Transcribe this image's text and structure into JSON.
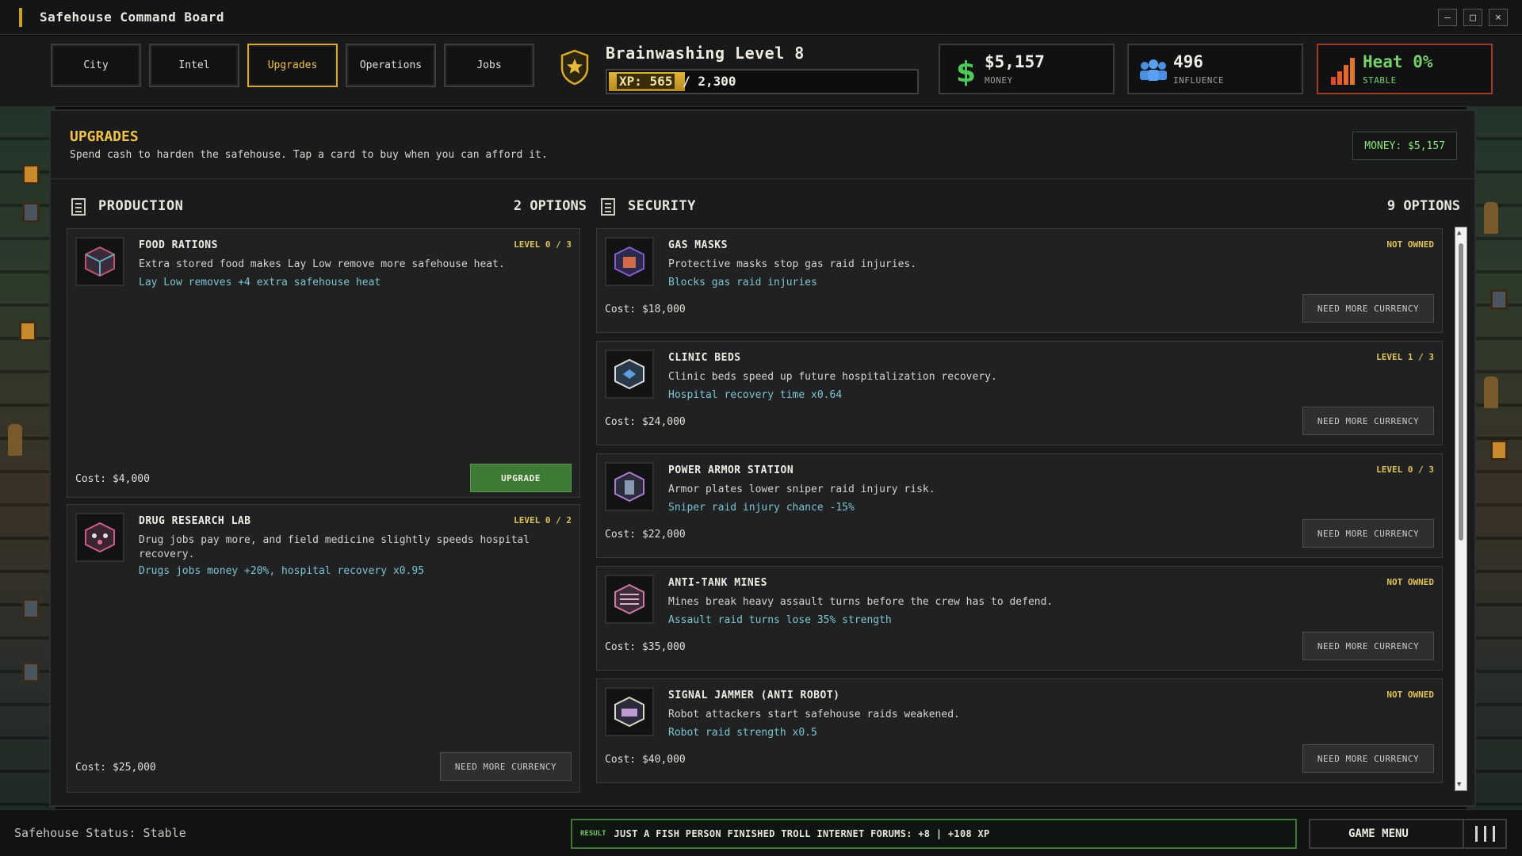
{
  "window": {
    "title": "Safehouse Command Board"
  },
  "tabs": [
    {
      "label": "City",
      "active": false
    },
    {
      "label": "Intel",
      "active": false
    },
    {
      "label": "Upgrades",
      "active": true
    },
    {
      "label": "Operations",
      "active": false
    },
    {
      "label": "Jobs",
      "active": false
    }
  ],
  "level": {
    "title": "Brainwashing Level 8",
    "xp_label": "XP:",
    "xp_current": "565",
    "xp_total": "/ 2,300",
    "xp_fraction": 0.2457
  },
  "stats": {
    "money": {
      "value": "$5,157",
      "label": "MONEY",
      "icon": "dollar-icon",
      "color": "#4fc85a"
    },
    "influence": {
      "value": "496",
      "label": "INFLUENCE",
      "icon": "people-icon",
      "color": "#4a8fe0"
    },
    "heat": {
      "value": "Heat 0%",
      "label": "STABLE",
      "icon": "signal-bars-icon",
      "color": "#78d06a"
    }
  },
  "panel": {
    "title": "UPGRADES",
    "subtitle": "Spend cash to harden the safehouse. Tap a card to buy when you can afford it.",
    "money_pill": "MONEY: $5,157"
  },
  "production": {
    "heading": "PRODUCTION",
    "count": "2 OPTIONS",
    "cards": [
      {
        "name": "FOOD RATIONS",
        "level": "LEVEL 0 / 3",
        "desc": "Extra stored food makes Lay Low remove more safehouse heat.",
        "effect": "Lay Low removes +4 extra safehouse heat",
        "cost": "Cost: $4,000",
        "button": "UPGRADE",
        "affordable": true
      },
      {
        "name": "DRUG RESEARCH LAB",
        "level": "LEVEL 0 / 2",
        "desc": "Drug jobs pay more, and field medicine slightly speeds hospital recovery.",
        "effect": "Drugs jobs money +20%, hospital recovery x0.95",
        "cost": "Cost: $25,000",
        "button": "NEED MORE CURRENCY",
        "affordable": false
      }
    ]
  },
  "security": {
    "heading": "SECURITY",
    "count": "9 OPTIONS",
    "cards": [
      {
        "name": "GAS MASKS",
        "level": "NOT OWNED",
        "desc": "Protective masks stop gas raid injuries.",
        "effect": "Blocks gas raid injuries",
        "cost": "Cost: $18,000",
        "button": "NEED MORE CURRENCY"
      },
      {
        "name": "CLINIC BEDS",
        "level": "LEVEL 1 / 3",
        "desc": "Clinic beds speed up future hospitalization recovery.",
        "effect": "Hospital recovery time x0.64",
        "cost": "Cost: $24,000",
        "button": "NEED MORE CURRENCY"
      },
      {
        "name": "POWER ARMOR STATION",
        "level": "LEVEL 0 / 3",
        "desc": "Armor plates lower sniper raid injury risk.",
        "effect": "Sniper raid injury chance -15%",
        "cost": "Cost: $22,000",
        "button": "NEED MORE CURRENCY"
      },
      {
        "name": "ANTI-TANK MINES",
        "level": "NOT OWNED",
        "desc": "Mines break heavy assault turns before the crew has to defend.",
        "effect": "Assault raid turns lose 35% strength",
        "cost": "Cost: $35,000",
        "button": "NEED MORE CURRENCY"
      },
      {
        "name": "SIGNAL JAMMER (ANTI ROBOT)",
        "level": "NOT OWNED",
        "desc": "Robot attackers start safehouse raids weakened.",
        "effect": "Robot raid strength x0.5",
        "cost": "Cost: $40,000",
        "button": "NEED MORE CURRENCY"
      }
    ]
  },
  "footer": {
    "status": "Safehouse Status: Stable",
    "result_tag": "RESULT",
    "result_msg": "JUST A FISH PERSON FINISHED TROLL INTERNET FORUMS: +8 | +108 XP",
    "game_menu": "GAME MENU"
  }
}
